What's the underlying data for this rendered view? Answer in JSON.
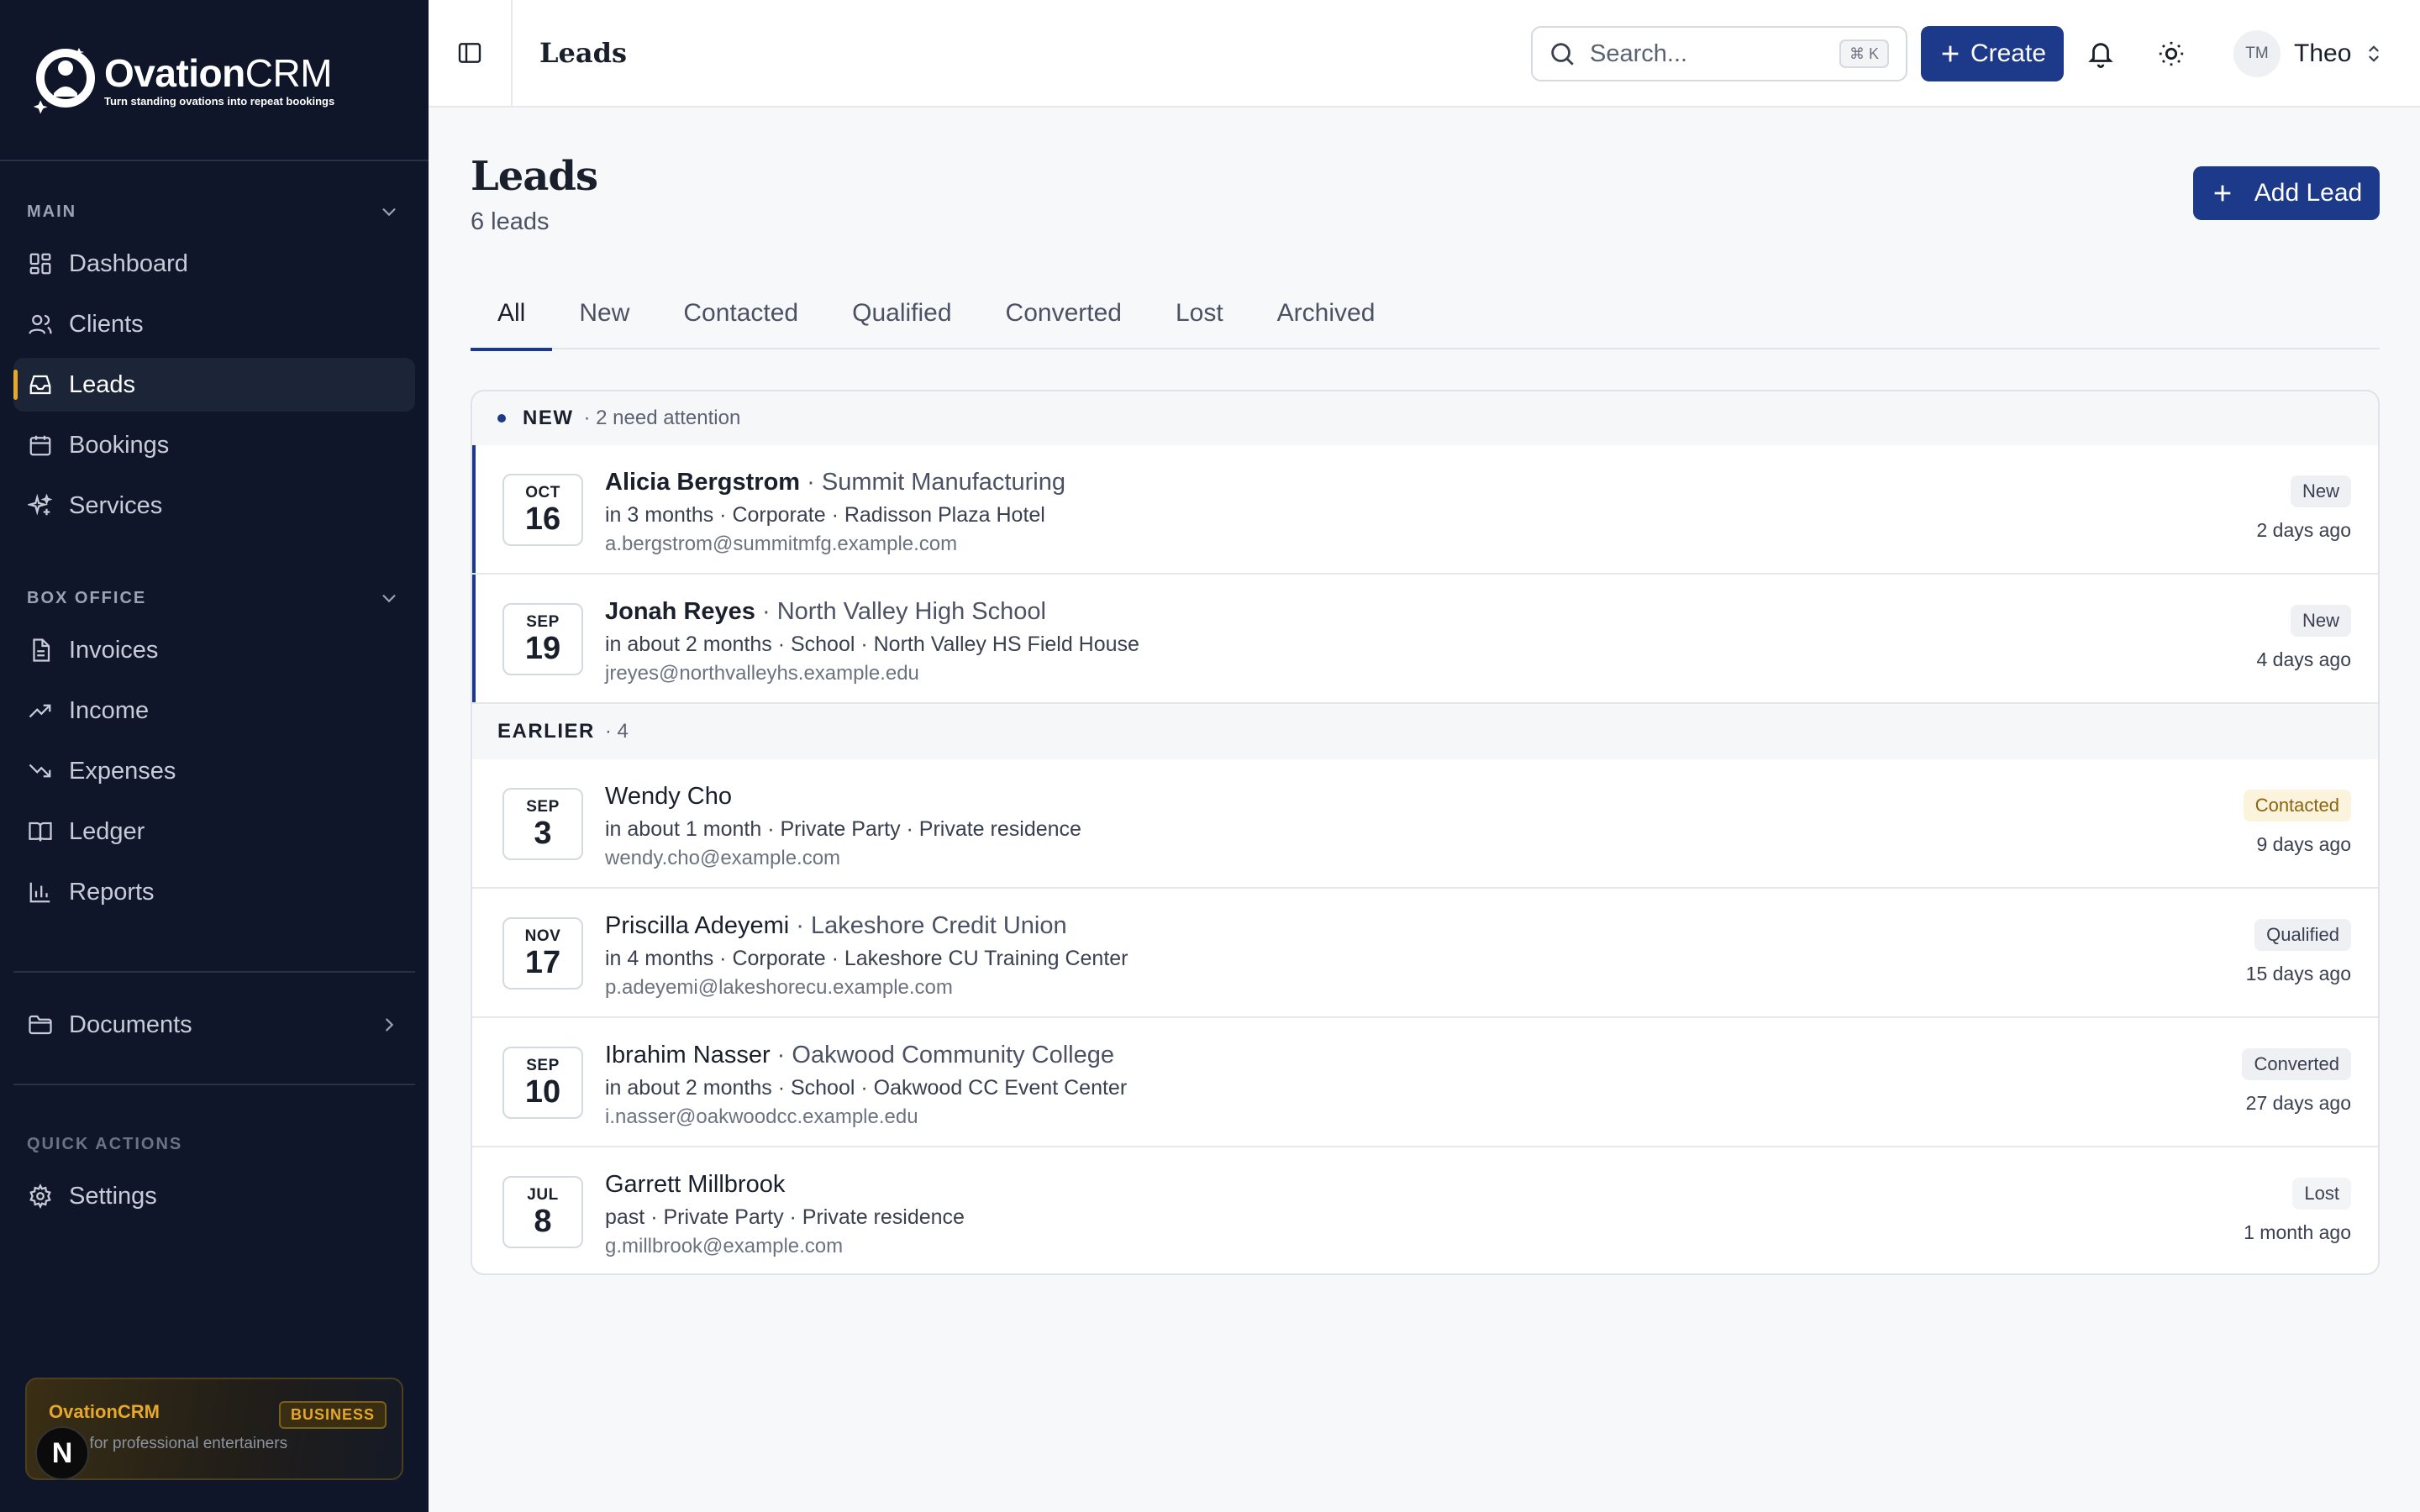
{
  "brand": {
    "name_bold": "Ovation",
    "name_light": "CRM",
    "tagline": "Turn standing ovations into repeat bookings"
  },
  "sidebar": {
    "main_label": "MAIN",
    "main_items": [
      {
        "label": "Dashboard",
        "icon": "dashboard-icon"
      },
      {
        "label": "Clients",
        "icon": "users-icon"
      },
      {
        "label": "Leads",
        "icon": "inbox-icon",
        "active": true
      },
      {
        "label": "Bookings",
        "icon": "calendar-icon"
      },
      {
        "label": "Services",
        "icon": "sparkles-icon"
      }
    ],
    "box_label": "BOX OFFICE",
    "box_items": [
      {
        "label": "Invoices",
        "icon": "file-icon"
      },
      {
        "label": "Income",
        "icon": "trend-up-icon"
      },
      {
        "label": "Expenses",
        "icon": "trend-down-icon"
      },
      {
        "label": "Ledger",
        "icon": "book-icon"
      },
      {
        "label": "Reports",
        "icon": "bar-chart-icon"
      }
    ],
    "documents_label": "Documents",
    "quick_label": "QUICK ACTIONS",
    "settings_label": "Settings",
    "promo": {
      "name": "OvationCRM",
      "badge": "BUSINESS",
      "desc": "CRM for professional entertainers"
    },
    "next_badge": "N"
  },
  "topbar": {
    "title": "Leads",
    "search_placeholder": "Search...",
    "search_shortcut": "⌘ K",
    "create_label": "Create",
    "user_initials": "TM",
    "user_name": "Theo"
  },
  "page": {
    "title": "Leads",
    "subtitle": "6 leads",
    "add_label": "Add Lead"
  },
  "tabs": [
    "All",
    "New",
    "Contacted",
    "Qualified",
    "Converted",
    "Lost",
    "Archived"
  ],
  "groups": {
    "new_label": "NEW",
    "new_meta": "· 2 need attention",
    "earlier_label": "EARLIER",
    "earlier_meta": "· 4"
  },
  "leads": [
    {
      "mon": "OCT",
      "day": "16",
      "name": "Alicia Bergstrom",
      "org": " · Summit Manufacturing",
      "details": "in 3 months · Corporate · Radisson Plaza Hotel",
      "email": "a.bergstrom@summitmfg.example.com",
      "status": "New",
      "when": "2 days ago"
    },
    {
      "mon": "SEP",
      "day": "19",
      "name": "Jonah Reyes",
      "org": " · North Valley High School",
      "details": "in about 2 months · School · North Valley HS Field House",
      "email": "jreyes@northvalleyhs.example.edu",
      "status": "New",
      "when": "4 days ago"
    },
    {
      "mon": "SEP",
      "day": "3",
      "name": "Wendy Cho",
      "org": "",
      "details": "in about 1 month · Private Party · Private residence",
      "email": "wendy.cho@example.com",
      "status": "Contacted",
      "when": "9 days ago"
    },
    {
      "mon": "NOV",
      "day": "17",
      "name": "Priscilla Adeyemi",
      "org": " · Lakeshore Credit Union",
      "details": "in 4 months · Corporate · Lakeshore CU Training Center",
      "email": "p.adeyemi@lakeshorecu.example.com",
      "status": "Qualified",
      "when": "15 days ago"
    },
    {
      "mon": "SEP",
      "day": "10",
      "name": "Ibrahim Nasser",
      "org": " · Oakwood Community College",
      "details": "in about 2 months · School · Oakwood CC Event Center",
      "email": "i.nasser@oakwoodcc.example.edu",
      "status": "Converted",
      "when": "27 days ago"
    },
    {
      "mon": "JUL",
      "day": "8",
      "name": "Garrett Millbrook",
      "org": "",
      "details": "past · Private Party · Private residence",
      "email": "g.millbrook@example.com",
      "status": "Lost",
      "when": "1 month ago"
    }
  ],
  "colors": {
    "sidebar_bg": "#0f1629",
    "accent": "#1d3a8a",
    "active_marker": "#e6a72b",
    "contacted": "#8a6410"
  }
}
